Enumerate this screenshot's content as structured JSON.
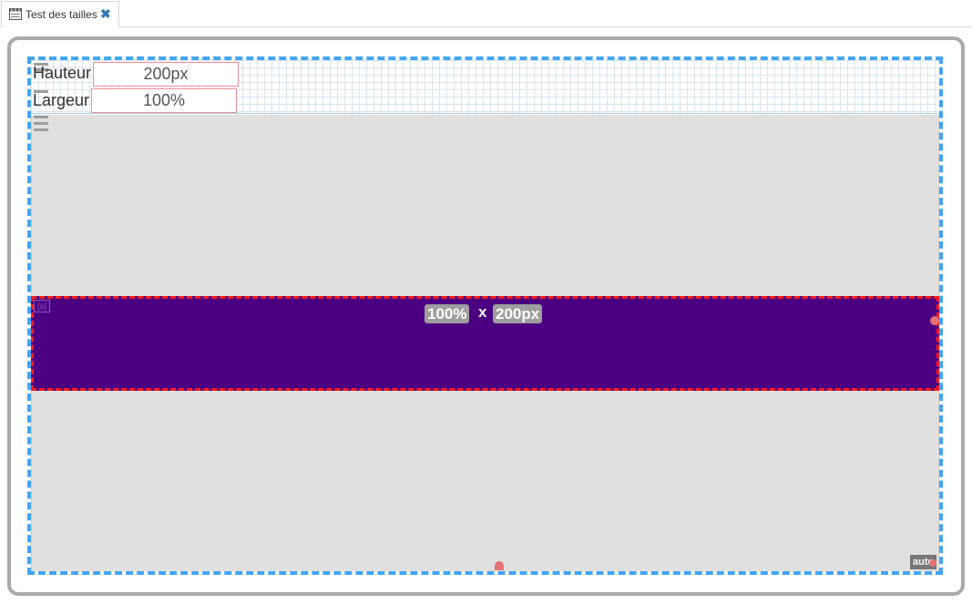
{
  "tab": {
    "title": "Test des tailles",
    "icon": "film-icon",
    "close_icon": "close-icon",
    "close_glyph": "✖"
  },
  "form": {
    "height_label": "Hauteur",
    "height_value": "200px",
    "width_label": "Largeur",
    "width_value": "100%"
  },
  "block": {
    "width_badge": "100%",
    "separator": "x",
    "height_badge": "200px",
    "corner_icon": "embed-icon",
    "corner_glyph": "{x}",
    "color": "#4b0082"
  },
  "container": {
    "size_badge": "auto",
    "accent_color": "#42a5f5",
    "selected_color": "#ff1a1a"
  }
}
